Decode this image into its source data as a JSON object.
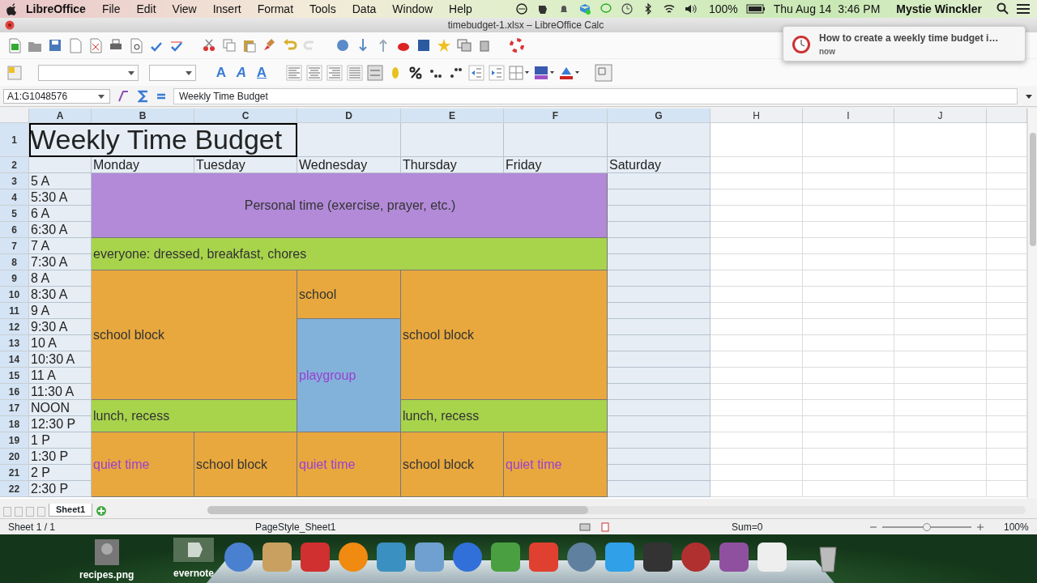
{
  "menu_bar": {
    "app": "LibreOffice",
    "menus": [
      "File",
      "Edit",
      "View",
      "Insert",
      "Format",
      "Tools",
      "Data",
      "Window",
      "Help"
    ],
    "battery": "100%",
    "clock": "Thu Aug 14  3:46 PM",
    "user": "Mystie Winckler"
  },
  "window": {
    "title": "timebudget-1.xlsx – LibreOffice Calc"
  },
  "format_toolbar": {
    "font_effects": [
      "A",
      "A",
      "A"
    ]
  },
  "formula_bar": {
    "cell_ref": "A1:G1048576",
    "content": "Weekly Time Budget"
  },
  "notification": {
    "title": "How to create a weekly time budget i…",
    "time": "now"
  },
  "columns": [
    {
      "label": "A",
      "selected": true
    },
    {
      "label": "B",
      "selected": true
    },
    {
      "label": "C",
      "selected": true
    },
    {
      "label": "D",
      "selected": true
    },
    {
      "label": "E",
      "selected": true
    },
    {
      "label": "F",
      "selected": true
    },
    {
      "label": "G",
      "selected": true
    },
    {
      "label": "H",
      "selected": false
    },
    {
      "label": "I",
      "selected": false
    },
    {
      "label": "J",
      "selected": false
    }
  ],
  "rows": [
    {
      "label": "1",
      "selected": true
    },
    {
      "label": "2",
      "selected": true
    },
    {
      "label": "3",
      "selected": true
    },
    {
      "label": "4",
      "selected": true
    },
    {
      "label": "5",
      "selected": true
    },
    {
      "label": "6",
      "selected": true
    },
    {
      "label": "7",
      "selected": true
    },
    {
      "label": "8",
      "selected": true
    },
    {
      "label": "9",
      "selected": true
    },
    {
      "label": "10",
      "selected": true
    },
    {
      "label": "11",
      "selected": true
    },
    {
      "label": "12",
      "selected": true
    },
    {
      "label": "13",
      "selected": true
    },
    {
      "label": "14",
      "selected": true
    },
    {
      "label": "15",
      "selected": true
    },
    {
      "label": "16",
      "selected": true
    },
    {
      "label": "17",
      "selected": true
    },
    {
      "label": "18",
      "selected": true
    },
    {
      "label": "19",
      "selected": true
    },
    {
      "label": "20",
      "selected": true
    },
    {
      "label": "21",
      "selected": true
    },
    {
      "label": "22",
      "selected": true
    }
  ],
  "sheet": {
    "title": {
      "text": "Weekly Time Budget",
      "selected": true
    },
    "day_headers": [
      "Monday",
      "Tuesday",
      "Wednesday",
      "Thursday",
      "Friday",
      "Saturday"
    ],
    "time_labels": [
      "5 A",
      "5:30 A",
      "6 A",
      "6:30 A",
      "7 A",
      "7:30 A",
      "8 A",
      "8:30 A",
      "9 A",
      "9:30 A",
      "10 A",
      "10:30 A",
      "11 A",
      "11:30 A",
      "NOON",
      "12:30 P",
      "1 P",
      "1:30 P",
      "2 P",
      "2:30 P"
    ],
    "blocks": [
      {
        "text": "Personal time (exercise, prayer, etc.)",
        "color": "#b28ad8",
        "accent_text": false
      },
      {
        "text": "everyone: dressed, breakfast, chores",
        "color": "#a8d44c",
        "accent_text": false
      },
      {
        "text": "school block",
        "color": "#e8a83e",
        "accent_text": false
      },
      {
        "text": "school",
        "color": "#e8a83e",
        "accent_text": false
      },
      {
        "text": "school block",
        "color": "#e8a83e",
        "accent_text": false
      },
      {
        "text": "playgroup",
        "color": "#82b2da",
        "accent_text": true
      },
      {
        "text": "lunch, recess",
        "color": "#a8d44c",
        "accent_text": false
      },
      {
        "text": "lunch, recess",
        "color": "#a8d44c",
        "accent_text": false
      },
      {
        "text": "quiet time",
        "color": "#e8a83e",
        "accent_text": true
      },
      {
        "text": "school block",
        "color": "#e8a83e",
        "accent_text": false
      },
      {
        "text": "quiet time",
        "color": "#e8a83e",
        "accent_text": true
      },
      {
        "text": "school block",
        "color": "#e8a83e",
        "accent_text": false
      },
      {
        "text": "quiet time",
        "color": "#e8a83e",
        "accent_text": true
      }
    ]
  },
  "sheet_tabs": [
    {
      "label": "Sheet1",
      "selected": true
    }
  ],
  "status_bar": {
    "sheet": "Sheet 1 / 1",
    "page_style": "PageStyle_Sheet1",
    "sum": "Sum=0",
    "zoom": "100%",
    "zoom_slider": {
      "level": 0.5
    }
  },
  "desktop": {
    "files": [
      {
        "label": "recipes.png"
      },
      {
        "label": "evernote"
      }
    ]
  }
}
